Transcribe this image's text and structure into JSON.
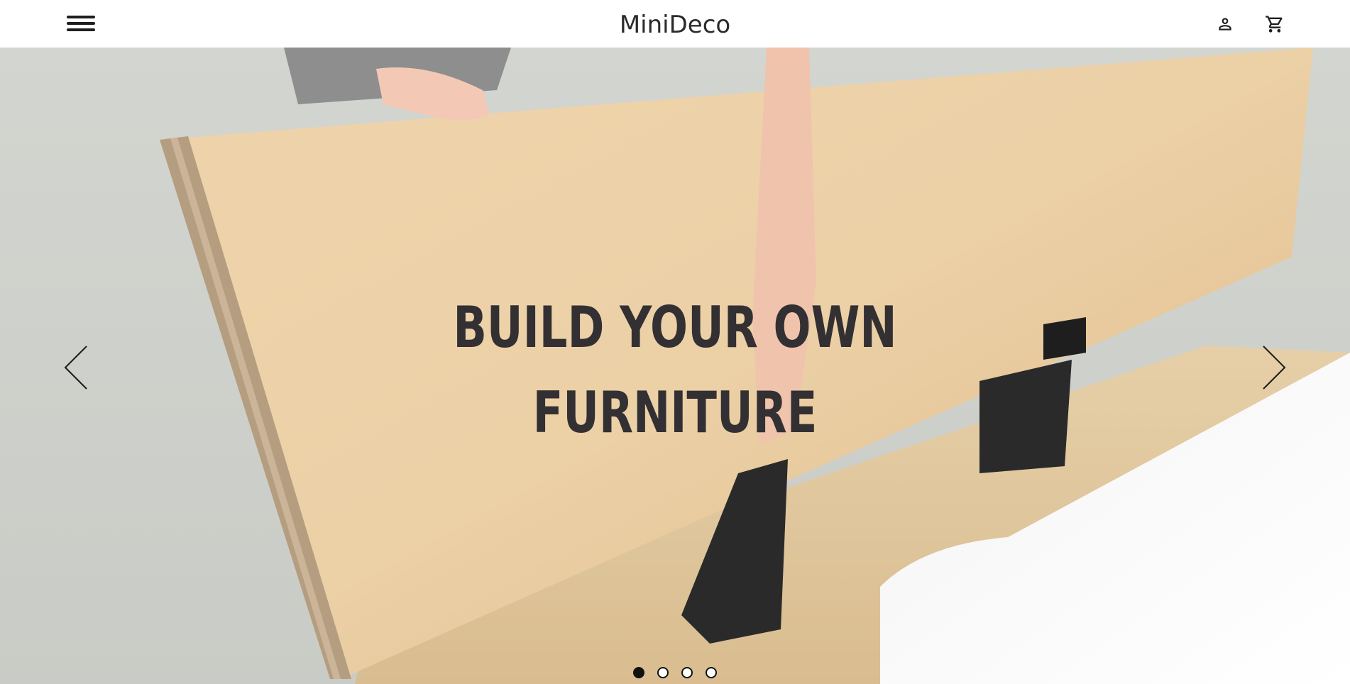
{
  "header": {
    "logo": "MiniDeco",
    "menu_icon": "hamburger-menu-icon",
    "user_icon": "user-icon",
    "cart_icon": "shopping-cart-icon"
  },
  "hero": {
    "title_line1": "BUILD YOUR OWN",
    "title_line2": "FURNITURE",
    "prev_icon": "chevron-left-icon",
    "next_icon": "chevron-right-icon",
    "slides_total": 4,
    "active_slide": 1
  },
  "colors": {
    "title": "#333033",
    "header_bg": "#ffffff",
    "dot": "#111111"
  }
}
